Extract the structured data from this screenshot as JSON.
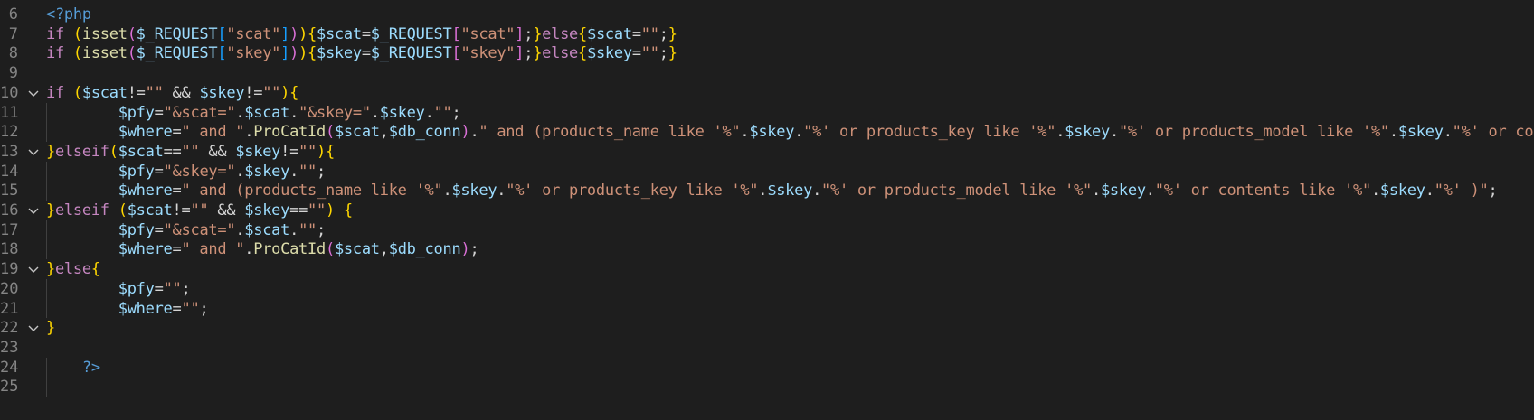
{
  "colors": {
    "background": "#1e1e1e",
    "line_number": "#858585",
    "tag": "#569cd6",
    "keyword": "#c586c0",
    "function": "#dcdcaa",
    "variable": "#9cdcfe",
    "string": "#ce9178",
    "default": "#d4d4d4",
    "bracket_1": "#ffd700",
    "bracket_2": "#da70d6",
    "bracket_3": "#179fff"
  },
  "lines": [
    {
      "n": "6",
      "fold": false,
      "tokens": [
        [
          "tag",
          "<?php"
        ]
      ]
    },
    {
      "n": "7",
      "fold": false,
      "tokens": [
        [
          "kw",
          "if"
        ],
        [
          "op",
          " "
        ],
        [
          "br",
          "("
        ],
        [
          "fn",
          "isset"
        ],
        [
          "br2",
          "("
        ],
        [
          "var",
          "$_REQUEST"
        ],
        [
          "br3",
          "["
        ],
        [
          "str",
          "\"scat\""
        ],
        [
          "br3",
          "]"
        ],
        [
          "br2",
          ")"
        ],
        [
          "br",
          ")"
        ],
        [
          "br",
          "{"
        ],
        [
          "var",
          "$scat"
        ],
        [
          "op",
          "="
        ],
        [
          "var",
          "$_REQUEST"
        ],
        [
          "br2",
          "["
        ],
        [
          "str",
          "\"scat\""
        ],
        [
          "br2",
          "]"
        ],
        [
          "op",
          ";"
        ],
        [
          "br",
          "}"
        ],
        [
          "kw",
          "else"
        ],
        [
          "br",
          "{"
        ],
        [
          "var",
          "$scat"
        ],
        [
          "op",
          "="
        ],
        [
          "str",
          "\"\""
        ],
        [
          "op",
          ";"
        ],
        [
          "br",
          "}"
        ]
      ]
    },
    {
      "n": "8",
      "fold": false,
      "tokens": [
        [
          "kw",
          "if"
        ],
        [
          "op",
          " "
        ],
        [
          "br",
          "("
        ],
        [
          "fn",
          "isset"
        ],
        [
          "br2",
          "("
        ],
        [
          "var",
          "$_REQUEST"
        ],
        [
          "br3",
          "["
        ],
        [
          "str",
          "\"skey\""
        ],
        [
          "br3",
          "]"
        ],
        [
          "br2",
          ")"
        ],
        [
          "br",
          ")"
        ],
        [
          "br",
          "{"
        ],
        [
          "var",
          "$skey"
        ],
        [
          "op",
          "="
        ],
        [
          "var",
          "$_REQUEST"
        ],
        [
          "br2",
          "["
        ],
        [
          "str",
          "\"skey\""
        ],
        [
          "br2",
          "]"
        ],
        [
          "op",
          ";"
        ],
        [
          "br",
          "}"
        ],
        [
          "kw",
          "else"
        ],
        [
          "br",
          "{"
        ],
        [
          "var",
          "$skey"
        ],
        [
          "op",
          "="
        ],
        [
          "str",
          "\"\""
        ],
        [
          "op",
          ";"
        ],
        [
          "br",
          "}"
        ]
      ]
    },
    {
      "n": "9",
      "fold": false,
      "tokens": []
    },
    {
      "n": "10",
      "fold": true,
      "tokens": [
        [
          "kw",
          "if"
        ],
        [
          "op",
          " "
        ],
        [
          "br",
          "("
        ],
        [
          "var",
          "$scat"
        ],
        [
          "op",
          "!="
        ],
        [
          "str",
          "\"\""
        ],
        [
          "op",
          " && "
        ],
        [
          "var",
          "$skey"
        ],
        [
          "op",
          "!="
        ],
        [
          "str",
          "\"\""
        ],
        [
          "br",
          ")"
        ],
        [
          "br",
          "{"
        ]
      ]
    },
    {
      "n": "11",
      "fold": false,
      "tokens": [
        [
          "op",
          "        "
        ],
        [
          "var",
          "$pfy"
        ],
        [
          "op",
          "="
        ],
        [
          "str",
          "\"&scat=\""
        ],
        [
          "op",
          "."
        ],
        [
          "var",
          "$scat"
        ],
        [
          "op",
          "."
        ],
        [
          "str",
          "\"&skey=\""
        ],
        [
          "op",
          "."
        ],
        [
          "var",
          "$skey"
        ],
        [
          "op",
          "."
        ],
        [
          "str",
          "\"\""
        ],
        [
          "op",
          ";"
        ]
      ]
    },
    {
      "n": "12",
      "fold": false,
      "tokens": [
        [
          "op",
          "        "
        ],
        [
          "var",
          "$where"
        ],
        [
          "op",
          "="
        ],
        [
          "str",
          "\" and \""
        ],
        [
          "op",
          "."
        ],
        [
          "fn",
          "ProCatId"
        ],
        [
          "br2",
          "("
        ],
        [
          "var",
          "$scat"
        ],
        [
          "op",
          ","
        ],
        [
          "var",
          "$db_conn"
        ],
        [
          "br2",
          ")"
        ],
        [
          "op",
          "."
        ],
        [
          "str",
          "\" and (products_name like '%\""
        ],
        [
          "op",
          "."
        ],
        [
          "var",
          "$skey"
        ],
        [
          "op",
          "."
        ],
        [
          "str",
          "\"%' or products_key like '%\""
        ],
        [
          "op",
          "."
        ],
        [
          "var",
          "$skey"
        ],
        [
          "op",
          "."
        ],
        [
          "str",
          "\"%' or products_model like '%\""
        ],
        [
          "op",
          "."
        ],
        [
          "var",
          "$skey"
        ],
        [
          "op",
          "."
        ],
        [
          "str",
          "\"%' or content"
        ]
      ]
    },
    {
      "n": "13",
      "fold": true,
      "tokens": [
        [
          "br",
          "}"
        ],
        [
          "kw",
          "elseif"
        ],
        [
          "br",
          "("
        ],
        [
          "var",
          "$scat"
        ],
        [
          "op",
          "=="
        ],
        [
          "str",
          "\"\""
        ],
        [
          "op",
          " && "
        ],
        [
          "var",
          "$skey"
        ],
        [
          "op",
          "!="
        ],
        [
          "str",
          "\"\""
        ],
        [
          "br",
          ")"
        ],
        [
          "br",
          "{"
        ]
      ]
    },
    {
      "n": "14",
      "fold": false,
      "tokens": [
        [
          "op",
          "        "
        ],
        [
          "var",
          "$pfy"
        ],
        [
          "op",
          "="
        ],
        [
          "str",
          "\"&skey=\""
        ],
        [
          "op",
          "."
        ],
        [
          "var",
          "$skey"
        ],
        [
          "op",
          "."
        ],
        [
          "str",
          "\"\""
        ],
        [
          "op",
          ";"
        ]
      ]
    },
    {
      "n": "15",
      "fold": false,
      "tokens": [
        [
          "op",
          "        "
        ],
        [
          "var",
          "$where"
        ],
        [
          "op",
          "="
        ],
        [
          "str",
          "\" and (products_name like '%\""
        ],
        [
          "op",
          "."
        ],
        [
          "var",
          "$skey"
        ],
        [
          "op",
          "."
        ],
        [
          "str",
          "\"%' or products_key like '%\""
        ],
        [
          "op",
          "."
        ],
        [
          "var",
          "$skey"
        ],
        [
          "op",
          "."
        ],
        [
          "str",
          "\"%' or products_model like '%\""
        ],
        [
          "op",
          "."
        ],
        [
          "var",
          "$skey"
        ],
        [
          "op",
          "."
        ],
        [
          "str",
          "\"%' or contents like '%\""
        ],
        [
          "op",
          "."
        ],
        [
          "var",
          "$skey"
        ],
        [
          "op",
          "."
        ],
        [
          "str",
          "\"%' )\""
        ],
        [
          "op",
          ";"
        ]
      ]
    },
    {
      "n": "16",
      "fold": true,
      "tokens": [
        [
          "br",
          "}"
        ],
        [
          "kw",
          "elseif"
        ],
        [
          "op",
          " "
        ],
        [
          "br",
          "("
        ],
        [
          "var",
          "$scat"
        ],
        [
          "op",
          "!="
        ],
        [
          "str",
          "\"\""
        ],
        [
          "op",
          " && "
        ],
        [
          "var",
          "$skey"
        ],
        [
          "op",
          "=="
        ],
        [
          "str",
          "\"\""
        ],
        [
          "br",
          ")"
        ],
        [
          "op",
          " "
        ],
        [
          "br",
          "{"
        ]
      ]
    },
    {
      "n": "17",
      "fold": false,
      "tokens": [
        [
          "op",
          "        "
        ],
        [
          "var",
          "$pfy"
        ],
        [
          "op",
          "="
        ],
        [
          "str",
          "\"&scat=\""
        ],
        [
          "op",
          "."
        ],
        [
          "var",
          "$scat"
        ],
        [
          "op",
          "."
        ],
        [
          "str",
          "\"\""
        ],
        [
          "op",
          ";"
        ]
      ]
    },
    {
      "n": "18",
      "fold": false,
      "tokens": [
        [
          "op",
          "        "
        ],
        [
          "var",
          "$where"
        ],
        [
          "op",
          "="
        ],
        [
          "str",
          "\" and \""
        ],
        [
          "op",
          "."
        ],
        [
          "fn",
          "ProCatId"
        ],
        [
          "br2",
          "("
        ],
        [
          "var",
          "$scat"
        ],
        [
          "op",
          ","
        ],
        [
          "var",
          "$db_conn"
        ],
        [
          "br2",
          ")"
        ],
        [
          "op",
          ";"
        ]
      ]
    },
    {
      "n": "19",
      "fold": true,
      "tokens": [
        [
          "br",
          "}"
        ],
        [
          "kw",
          "else"
        ],
        [
          "br",
          "{"
        ]
      ]
    },
    {
      "n": "20",
      "fold": false,
      "tokens": [
        [
          "op",
          "        "
        ],
        [
          "var",
          "$pfy"
        ],
        [
          "op",
          "="
        ],
        [
          "str",
          "\"\""
        ],
        [
          "op",
          ";"
        ]
      ]
    },
    {
      "n": "21",
      "fold": false,
      "tokens": [
        [
          "op",
          "        "
        ],
        [
          "var",
          "$where"
        ],
        [
          "op",
          "="
        ],
        [
          "str",
          "\"\""
        ],
        [
          "op",
          ";"
        ]
      ]
    },
    {
      "n": "22",
      "fold": true,
      "tokens": [
        [
          "br",
          "}"
        ]
      ]
    },
    {
      "n": "23",
      "fold": false,
      "tokens": []
    },
    {
      "n": "24",
      "fold": false,
      "tokens": [
        [
          "op",
          "    "
        ],
        [
          "tag",
          "?>"
        ]
      ]
    },
    {
      "n": "25",
      "fold": false,
      "tokens": []
    }
  ]
}
